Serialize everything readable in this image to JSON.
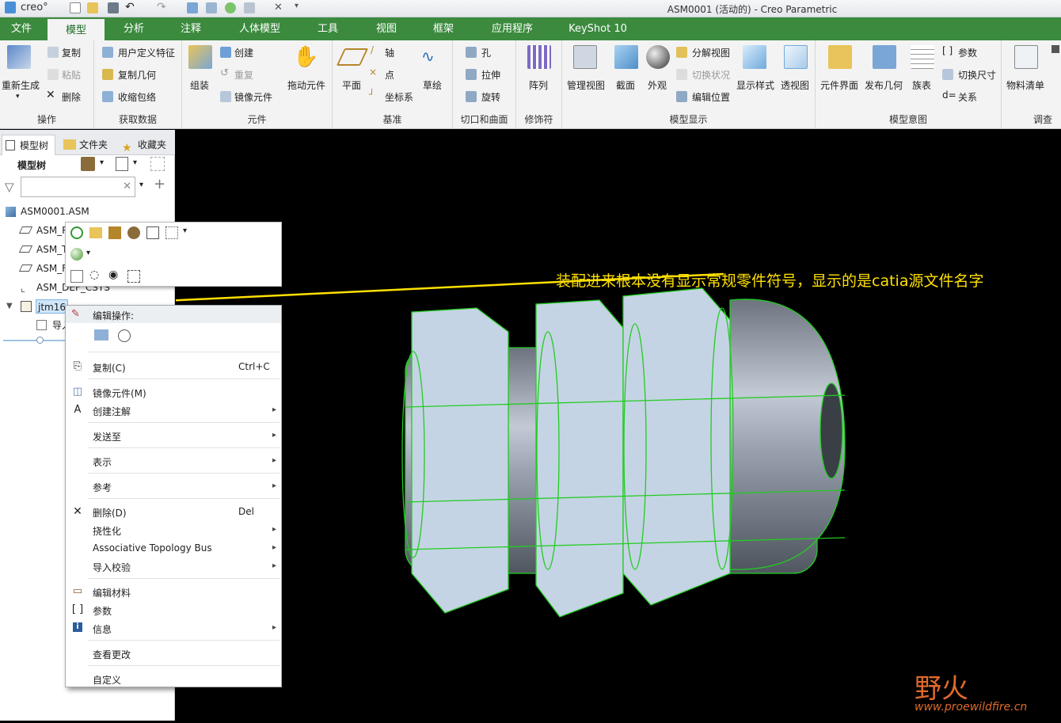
{
  "app": {
    "logo_text": "creo°",
    "window_title": "ASM0001 (活动的) - Creo Parametric"
  },
  "tabs": [
    "文件",
    "模型",
    "分析",
    "注释",
    "人体模型",
    "工具",
    "视图",
    "框架",
    "应用程序",
    "KeyShot 10"
  ],
  "ribbon": {
    "ops": {
      "regen": "重新生成",
      "copy": "复制",
      "paste": "粘贴",
      "delete": "删除",
      "label": "操作"
    },
    "getdata": {
      "udf": "用户定义特征",
      "copygeom": "复制几何",
      "shrinkwrap": "收缩包络",
      "label": "获取数据"
    },
    "component": {
      "assemble": "组装",
      "create": "创建",
      "repeat": "重复",
      "mirror": "镜像元件",
      "drag": "拖动元件",
      "label": "元件"
    },
    "datum": {
      "plane": "平面",
      "axis": "轴",
      "point": "点",
      "csys": "坐标系",
      "sketch": "草绘",
      "label": "基准"
    },
    "cutsurf": {
      "hole": "孔",
      "extrude": "拉伸",
      "revolve": "旋转",
      "label": "切口和曲面"
    },
    "modifiers": {
      "pattern": "阵列",
      "label": "修饰符"
    },
    "display": {
      "manage": "管理视图",
      "section": "截面",
      "appearance": "外观",
      "explode": "分解视图",
      "toggle": "切换状况",
      "editpos": "编辑位置",
      "style": "显示样式",
      "perspective": "透视图",
      "label": "模型显示"
    },
    "intent": {
      "interface": "元件界面",
      "publish": "发布几何",
      "family": "族表",
      "params": "参数",
      "switchdim": "切换尺寸",
      "relations": "关系",
      "label": "模型意图"
    },
    "investigate": {
      "bom": "物料清单",
      "label": "调查"
    }
  },
  "leftpane": {
    "tabs": [
      "模型树",
      "文件夹",
      "收藏夹"
    ],
    "toolbar_label": "模型树",
    "tree": [
      {
        "label": "ASM0001.ASM",
        "icon": "assembly-icon"
      },
      {
        "label": "ASM_R",
        "icon": "datum-plane-icon"
      },
      {
        "label": "ASM_T",
        "icon": "datum-plane-icon"
      },
      {
        "label": "ASM_F",
        "icon": "datum-plane-icon"
      },
      {
        "label": "ASM_DEF_CSYS",
        "icon": "csys-icon"
      },
      {
        "label": "jtm16",
        "icon": "part-icon"
      },
      {
        "label": "导入",
        "icon": "import-feature-icon"
      }
    ]
  },
  "context_menu": {
    "header": "编辑操作:",
    "items": [
      {
        "label": "复制(C)",
        "shortcut": "Ctrl+C",
        "icon": "copy-icon",
        "submenu": false
      },
      {
        "label": "镜像元件(M)",
        "shortcut": "",
        "icon": "mirror-icon",
        "submenu": false
      },
      {
        "label": "创建注解",
        "shortcut": "",
        "icon": "annotation-icon",
        "submenu": true
      },
      {
        "label": "发送至",
        "shortcut": "",
        "icon": "",
        "submenu": true
      },
      {
        "label": "表示",
        "shortcut": "",
        "icon": "",
        "submenu": true
      },
      {
        "label": "参考",
        "shortcut": "",
        "icon": "",
        "submenu": true
      },
      {
        "label": "删除(D)",
        "shortcut": "Del",
        "icon": "delete-icon",
        "submenu": false
      },
      {
        "label": "挠性化",
        "shortcut": "",
        "icon": "",
        "submenu": true
      },
      {
        "label": "Associative Topology Bus",
        "shortcut": "",
        "icon": "",
        "submenu": true
      },
      {
        "label": "导入校验",
        "shortcut": "",
        "icon": "",
        "submenu": true
      },
      {
        "label": "编辑材料",
        "shortcut": "",
        "icon": "material-icon",
        "submenu": false
      },
      {
        "label": "参数",
        "shortcut": "",
        "icon": "parameters-icon",
        "submenu": false
      },
      {
        "label": "信息",
        "shortcut": "",
        "icon": "info-icon",
        "submenu": true
      },
      {
        "label": "查看更改",
        "shortcut": "",
        "icon": "",
        "submenu": false
      },
      {
        "label": "自定义",
        "shortcut": "",
        "icon": "",
        "submenu": false
      }
    ]
  },
  "annotation": "装配进来根本没有显示常规零件符号，显示的是catia源文件名字",
  "watermark": {
    "logo": "野火",
    "url": "www.proewildfire.cn"
  },
  "colors": {
    "accent": "#3b8a3e",
    "highlight": "#cfe6f9",
    "annotation": "#ffe000",
    "edges": "#22cc22"
  }
}
